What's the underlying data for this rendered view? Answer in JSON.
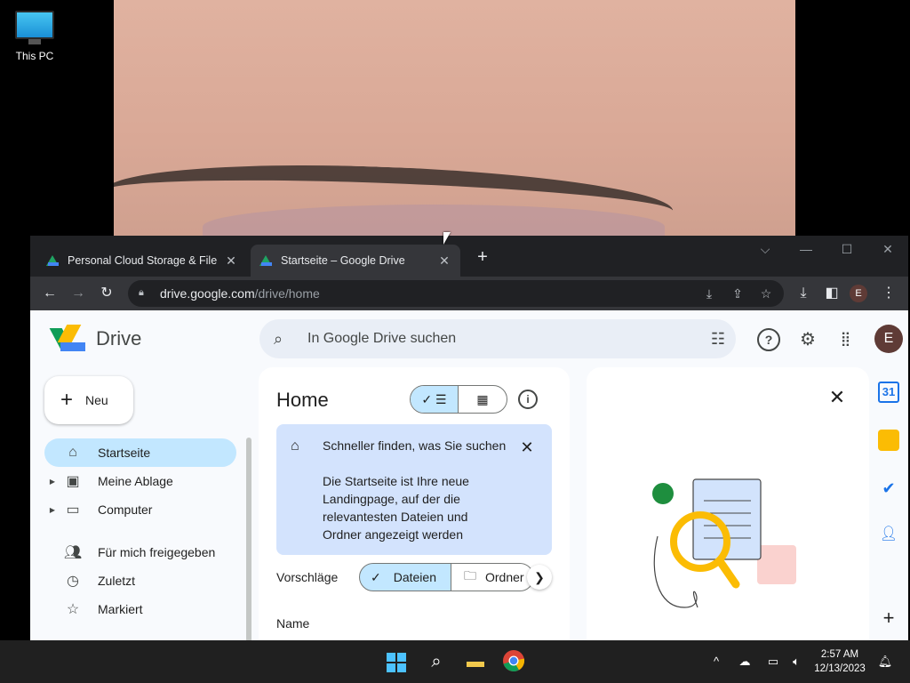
{
  "desktop": {
    "icon_label": "This PC"
  },
  "browser": {
    "tabs": [
      {
        "title": "Personal Cloud Storage & File Sh",
        "close": "✕"
      },
      {
        "title": "Startseite – Google Drive",
        "close": "✕"
      }
    ],
    "new_tab": "+",
    "window_controls": {
      "dropdown": "⌵",
      "minimize": "—",
      "maximize": "☐",
      "close": "✕"
    },
    "url_host": "drive.google.com",
    "url_path": "/drive/home",
    "profile_initial": "E"
  },
  "drive": {
    "app_name": "Drive",
    "search_placeholder": "In Google Drive suchen",
    "new_label": "Neu",
    "avatar_initial": "E",
    "nav": [
      {
        "label": "Startseite",
        "icon": "home-icon"
      },
      {
        "label": "Meine Ablage",
        "icon": "my-drive-icon"
      },
      {
        "label": "Computer",
        "icon": "computer-icon"
      },
      {
        "label": "Für mich freigegeben",
        "icon": "shared-icon"
      },
      {
        "label": "Zuletzt",
        "icon": "recent-icon"
      },
      {
        "label": "Markiert",
        "icon": "star-icon"
      }
    ],
    "home_title": "Home",
    "banner": {
      "title": "Schneller finden, was Sie suchen",
      "body": "Die Startseite ist Ihre neue Landingpage, auf der die relevantesten Dateien und Ordner angezeigt werden"
    },
    "suggestions_label": "Vorschläge",
    "chip_files": "Dateien",
    "chip_folders": "Ordner",
    "column_name": "Name",
    "accent_color": "#c2e7ff",
    "banner_color": "#d3e3fd"
  },
  "taskbar": {
    "time": "2:57 AM",
    "date": "12/13/2023"
  }
}
